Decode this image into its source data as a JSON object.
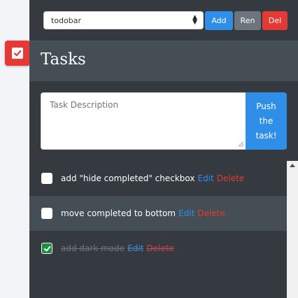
{
  "sidebar": {
    "toggle_icon": "checkbox-icon",
    "toggle_color": "#e53935"
  },
  "toolbar": {
    "list_select_value": "todobar",
    "add_label": "Add",
    "rename_label": "Ren",
    "delete_label": "Del"
  },
  "header": {
    "title": "Tasks"
  },
  "new_task": {
    "placeholder": "Task Description",
    "push_label_line1": "Push",
    "push_label_line2": "the",
    "push_label_line3": "task!"
  },
  "tasks": [
    {
      "text": "add \"hide completed\" checkbox",
      "completed": false,
      "edit_label": "Edit",
      "delete_label": "Delete"
    },
    {
      "text": "move completed to bottom",
      "completed": false,
      "edit_label": "Edit",
      "delete_label": "Delete"
    },
    {
      "text": "add dark mode",
      "completed": true,
      "edit_label": "Edit",
      "delete_label": "Delete"
    }
  ],
  "colors": {
    "panel_bg": "#343a40",
    "accent_blue": "#2f8fe8",
    "accent_red": "#e53935",
    "check_green": "#1e8e3e"
  }
}
